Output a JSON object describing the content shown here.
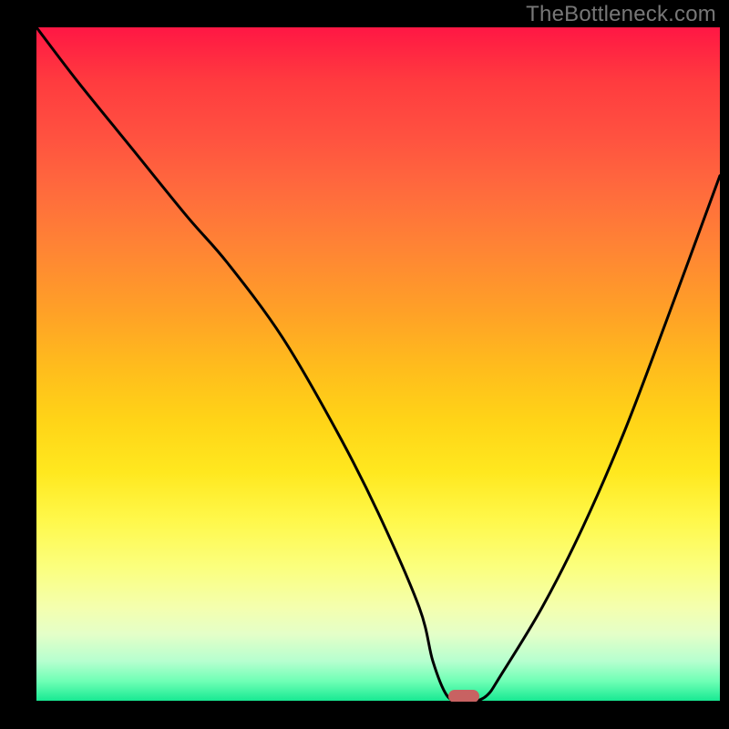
{
  "watermark": "TheBottleneck.com",
  "chart_data": {
    "type": "line",
    "title": "",
    "xlabel": "",
    "ylabel": "",
    "xlim": [
      0,
      100
    ],
    "ylim": [
      0,
      100
    ],
    "grid": false,
    "gradient_colors": {
      "top": "#ff1744",
      "upper_mid": "#ffa027",
      "mid": "#ffe81f",
      "lower_mid": "#f4ffae",
      "bottom": "#14e891"
    },
    "series": [
      {
        "name": "bottleneck-curve",
        "color": "#000000",
        "x": [
          0,
          6,
          14,
          22,
          28,
          36,
          44,
          50,
          56,
          58,
          60,
          62,
          64,
          66,
          68,
          74,
          80,
          86,
          92,
          100
        ],
        "y": [
          100,
          92,
          82,
          72,
          65,
          54,
          40,
          28,
          14,
          6,
          1,
          0,
          0,
          1,
          4,
          14,
          26,
          40,
          56,
          78
        ]
      }
    ],
    "marker": {
      "x": 62.5,
      "y": 0.8,
      "color": "#c86262"
    },
    "background": "#000000"
  }
}
